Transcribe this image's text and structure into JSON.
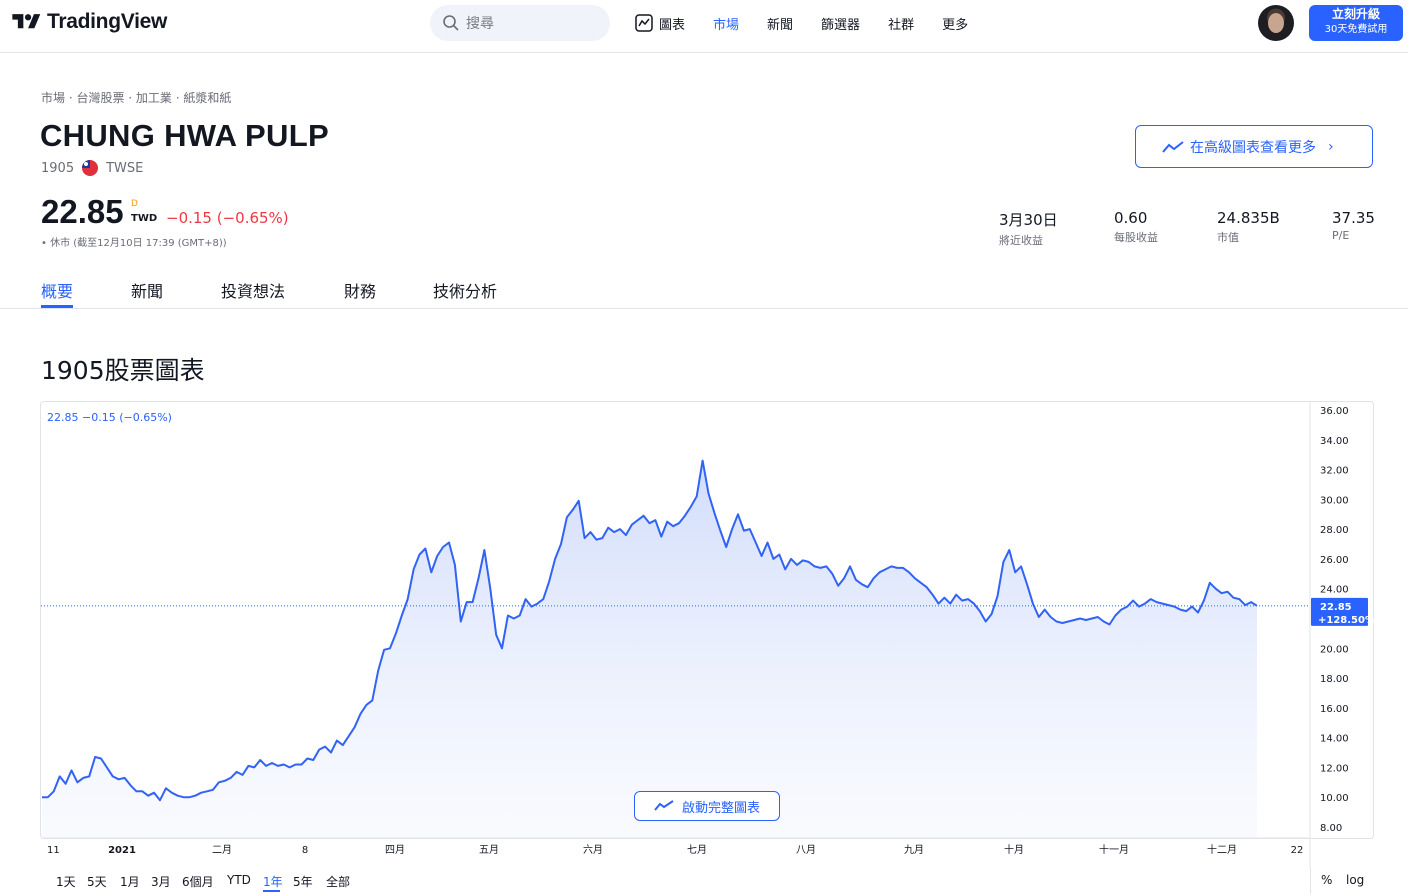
{
  "header": {
    "logo_text": "TradingView",
    "search_placeholder": "搜尋",
    "nav": [
      {
        "label": "圖表",
        "icon": "chart-icon",
        "active": false
      },
      {
        "label": "市場",
        "active": true
      },
      {
        "label": "新聞",
        "active": false
      },
      {
        "label": "篩選器",
        "active": false
      },
      {
        "label": "社群",
        "active": false
      },
      {
        "label": "更多",
        "active": false
      }
    ],
    "upgrade_line1": "立刻升級",
    "upgrade_line2": "30天免費試用"
  },
  "symbol": {
    "breadcrumb": "市場 · 台灣股票 · 加工業 · 紙漿和紙",
    "name": "CHUNG HWA PULP",
    "ticker": "1905",
    "exchange": "TWSE",
    "advanced_chart_label": "在高級圖表查看更多",
    "price": "22.85",
    "price_flag": "D",
    "currency": "TWD",
    "change": "−0.15 (−0.65%)",
    "market_status": "• 休市 (截至12月10日 17:39 (GMT+8))"
  },
  "stats": [
    {
      "value": "3月30日",
      "label": "將近收益"
    },
    {
      "value": "0.60",
      "label": "每股收益"
    },
    {
      "value": "24.835B",
      "label": "市值"
    },
    {
      "value": "37.35",
      "label": "P/E"
    }
  ],
  "tabs": [
    "概要",
    "新聞",
    "投資想法",
    "財務",
    "技術分析"
  ],
  "section_title": "1905股票圖表",
  "chart_legend": "22.85  −0.15 (−0.65%)",
  "launch_label": "啟動完整圖表",
  "ranges": [
    "1天",
    "5天",
    "1月",
    "3月",
    "6個月",
    "YTD",
    "1年",
    "5年",
    "全部"
  ],
  "active_range": "1年",
  "right_controls": [
    "%",
    "log"
  ],
  "colors": {
    "accent": "#2962ff",
    "negative": "#f23645",
    "line": "#3163f4",
    "area_top": "#d7e1fb"
  },
  "chart_data": {
    "type": "area",
    "title": "",
    "xlabel": "",
    "ylabel": "",
    "ylim": [
      8,
      36
    ],
    "y_ticks": [
      "36.00",
      "34.00",
      "32.00",
      "30.00",
      "28.00",
      "26.00",
      "24.00",
      "22.00",
      "20.00",
      "18.00",
      "16.00",
      "14.00",
      "12.00",
      "10.00",
      "8.00"
    ],
    "x_ticks": [
      "11",
      "2021",
      "二月",
      "8",
      "四月",
      "五月",
      "六月",
      "七月",
      "八月",
      "九月",
      "十月",
      "十一月",
      "十二月",
      "22"
    ],
    "last_value_label": "22.85",
    "last_change_label": "+128.50%",
    "last_value": 22.85,
    "series": [
      {
        "values": [
          10.0,
          10.0,
          10.4,
          11.4,
          10.9,
          11.8,
          11.0,
          11.3,
          11.4,
          12.7,
          12.6,
          12.0,
          11.4,
          11.2,
          11.3,
          10.8,
          10.4,
          10.4,
          10.1,
          10.3,
          9.8,
          10.6,
          10.3,
          10.1,
          10.0,
          10.0,
          10.1,
          10.3,
          10.4,
          10.5,
          11.0,
          11.1,
          11.3,
          11.7,
          11.5,
          12.1,
          12.0,
          12.5,
          12.1,
          12.3,
          12.1,
          12.2,
          12.0,
          12.2,
          12.2,
          12.6,
          12.5,
          13.2,
          13.4,
          13.0,
          13.8,
          13.5,
          14.1,
          14.7,
          15.6,
          16.2,
          16.5,
          18.5,
          19.9,
          20.0,
          21.0,
          22.2,
          23.3,
          25.3,
          26.3,
          26.7,
          25.1,
          26.2,
          26.8,
          27.1,
          25.6,
          21.8,
          23.1,
          23.1,
          24.7,
          26.6,
          24.0,
          20.9,
          20.0,
          22.2,
          22.0,
          22.2,
          23.3,
          22.8,
          23.0,
          23.3,
          24.5,
          26.0,
          27.0,
          28.8,
          29.3,
          29.9,
          27.4,
          27.8,
          27.3,
          27.4,
          28.1,
          27.8,
          28.0,
          27.6,
          28.3,
          28.6,
          28.9,
          28.4,
          28.6,
          27.5,
          28.5,
          28.2,
          28.4,
          28.9,
          29.5,
          30.2,
          32.6,
          30.4,
          29.1,
          27.9,
          26.8,
          28.0,
          29.0,
          27.9,
          28.0,
          27.1,
          26.2,
          27.1,
          26.0,
          26.3,
          25.3,
          26.0,
          25.6,
          25.9,
          25.8,
          25.5,
          25.4,
          25.5,
          25.0,
          24.2,
          24.7,
          25.5,
          24.6,
          24.3,
          24.1,
          24.7,
          25.1,
          25.3,
          25.5,
          25.4,
          25.4,
          25.1,
          24.7,
          24.4,
          24.1,
          23.6,
          23.0,
          23.4,
          23.0,
          23.6,
          23.2,
          23.3,
          23.0,
          22.5,
          21.8,
          22.3,
          23.5,
          25.8,
          26.6,
          25.1,
          25.5,
          24.3,
          23.0,
          22.1,
          22.6,
          22.1,
          21.8,
          21.7,
          21.8,
          21.9,
          22.0,
          21.9,
          22.0,
          22.1,
          21.8,
          21.6,
          22.2,
          22.6,
          22.8,
          23.2,
          22.8,
          23.0,
          23.3,
          23.1,
          23.0,
          22.9,
          22.8,
          22.6,
          22.5,
          22.8,
          22.4,
          23.2,
          24.4,
          24.0,
          23.7,
          23.8,
          23.4,
          23.3,
          22.9,
          23.1,
          22.85
        ]
      }
    ],
    "price_line": 22.85
  }
}
